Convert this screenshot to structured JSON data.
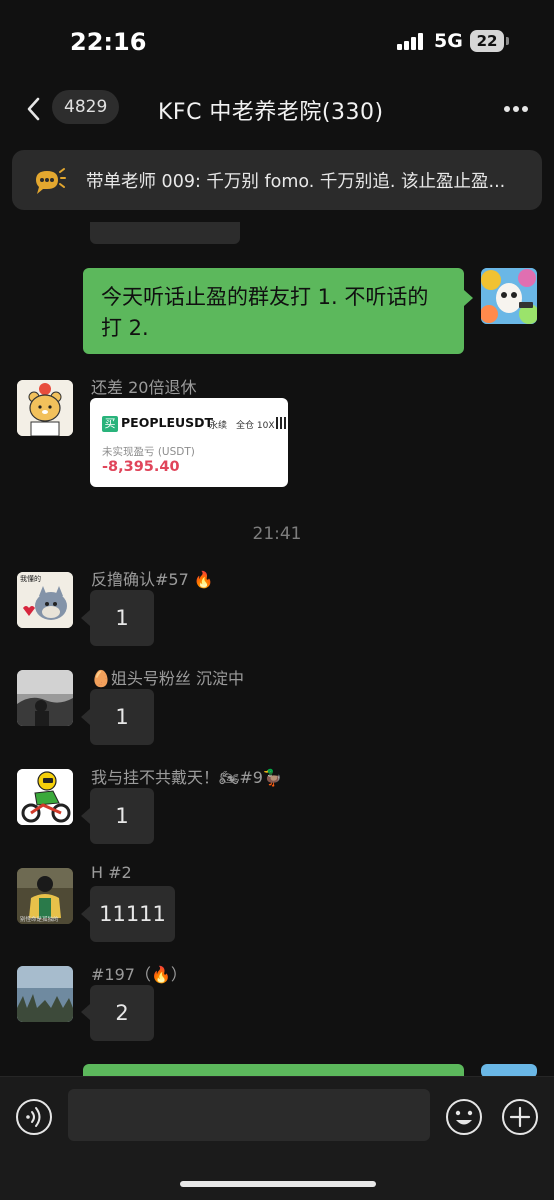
{
  "status_bar": {
    "time": "22:16",
    "network": "5G",
    "battery": "22"
  },
  "nav": {
    "unread_count": "4829",
    "title": "KFC  中老养老院(330)"
  },
  "pinned": {
    "text": "带单老师 009: 千万别 fomo. 千万别追. 该止盈止盈..."
  },
  "messages": {
    "out_1": "今天听话止盈的群友打 1. 不听话的打 2.",
    "card_sender": "还差 20倍退休",
    "card": {
      "buy_badge": "买",
      "pair": "PEOPLEUSDT",
      "perpetual": "永续",
      "leverage": "全仓 10X",
      "pnl_label": "未实现盈亏 (USDT)",
      "pnl_value": "-8,395.40"
    },
    "timestamp": "21:41",
    "m1_sender": "反撸确认#57 🔥",
    "m1_text": "1",
    "m2_sender": "🥚姐头号粉丝 沉淀中",
    "m2_text": "1",
    "m3_sender": "我与挂不共戴天！🏍#9🦆",
    "m3_text": "1",
    "m4_sender": "H   #2",
    "m4_text": "11111",
    "m5_sender": "#197（🔥）",
    "m5_text": "2"
  },
  "avatars": {
    "tom_caption": "我懂的",
    "h_caption": "别怪命是孤独的"
  },
  "input": {
    "placeholder": ""
  },
  "colors": {
    "background": "#111111",
    "incoming_bubble": "#2c2c2c",
    "outgoing_bubble": "#5cb85c",
    "pnl_negative": "#e0455a",
    "buy_green": "#29b37b"
  }
}
